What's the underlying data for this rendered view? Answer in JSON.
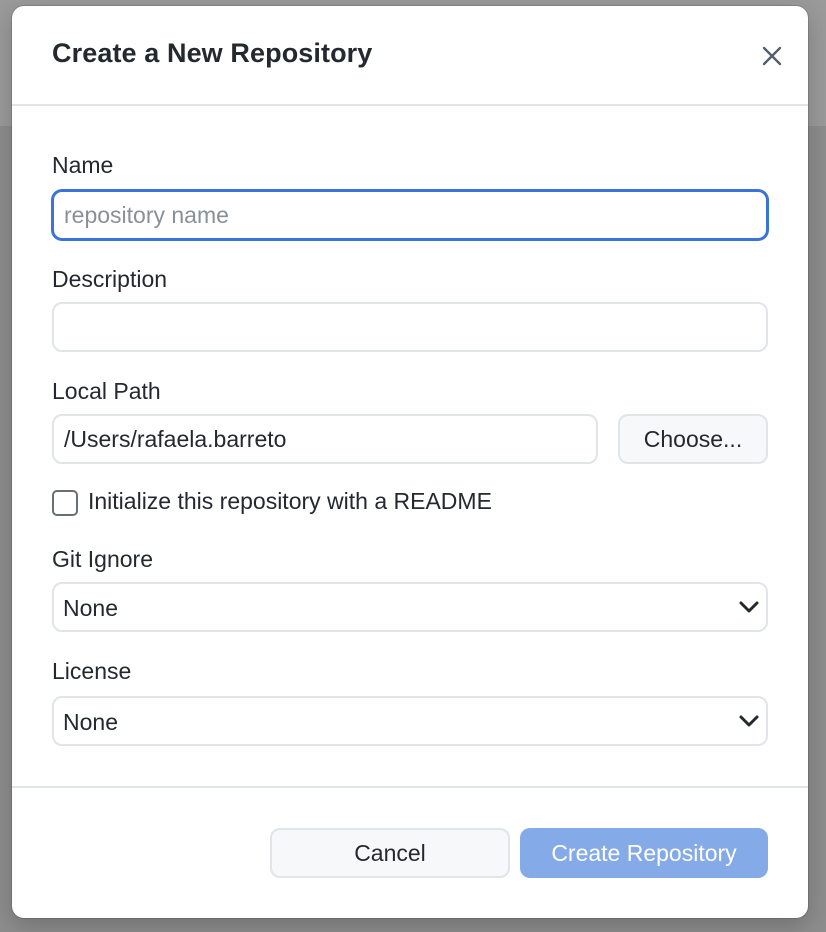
{
  "dialog": {
    "title": "Create a New Repository",
    "close_icon": "close-icon"
  },
  "form": {
    "name": {
      "label": "Name",
      "value": "",
      "placeholder": "repository name"
    },
    "description": {
      "label": "Description",
      "value": "",
      "placeholder": ""
    },
    "local_path": {
      "label": "Local Path",
      "value": "/Users/rafaela.barreto",
      "choose_label": "Choose..."
    },
    "readme": {
      "label": "Initialize this repository with a README",
      "checked": false
    },
    "gitignore": {
      "label": "Git Ignore",
      "selected": "None"
    },
    "license": {
      "label": "License",
      "selected": "None"
    }
  },
  "footer": {
    "cancel_label": "Cancel",
    "create_label": "Create Repository"
  },
  "colors": {
    "accent": "#3b74d8",
    "primary_disabled": "#85aae8",
    "border": "#e1e4e8",
    "text": "#24292f",
    "backdrop": "#8d8d8d"
  }
}
